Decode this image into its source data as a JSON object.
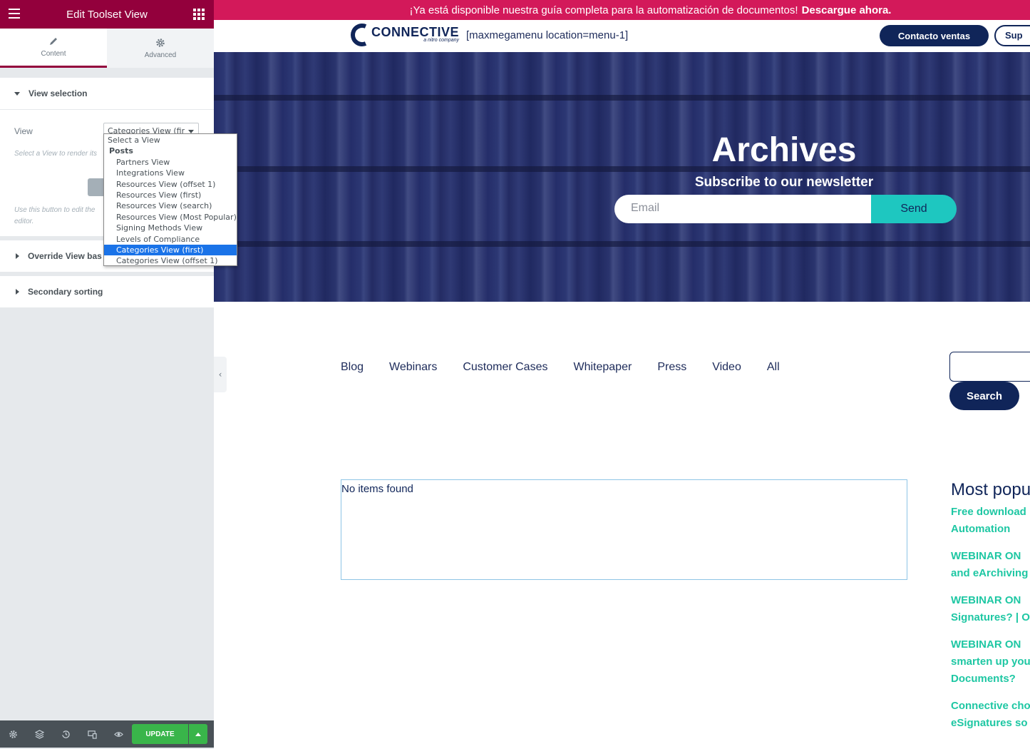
{
  "editor": {
    "title": "Edit Toolset View",
    "tabs": [
      {
        "label": "Content"
      },
      {
        "label": "Advanced"
      }
    ],
    "sections": {
      "view_selection": "View selection",
      "override": "Override View bas",
      "secondary_sorting": "Secondary sorting"
    },
    "view_label": "View",
    "view_select_value": "Categories View (first)",
    "view_help": "Select a View to render its",
    "edit_help_line1": "Use this button to edit the",
    "edit_help_line2": "editor.",
    "dropdown": {
      "top": "Select a View",
      "group": "Posts",
      "items": [
        "Partners View",
        "Integrations View",
        "Resources View (offset 1)",
        "Resources View (first)",
        "Resources View (search)",
        "Resources View (Most Popular)",
        "Signing Methods View",
        "Levels of Compliance",
        "Categories View (first)",
        "Categories View (offset 1)"
      ],
      "selected": "Categories View (first)"
    },
    "update_label": "UPDATE",
    "colors": {
      "brand": "#93003c",
      "update": "#39b54a",
      "highlight": "#1a73e8"
    }
  },
  "site": {
    "announcement": "¡Ya está disponible nuestra guía completa para la automatización de documentos!",
    "announcement_link": "Descargue ahora.",
    "logo_name": "CONNECTIVE",
    "logo_sub": "a nitro company",
    "menu_shortcode": "[maxmegamenu location=menu-1]",
    "contact_button": "Contacto ventas",
    "support_button": "Sup",
    "hero": {
      "title": "Archives",
      "subtitle": "Subscribe to our newsletter",
      "email_placeholder": "Email",
      "send_button": "Send"
    },
    "categories": [
      "Blog",
      "Webinars",
      "Customer Cases",
      "Whitepaper",
      "Press",
      "Video",
      "All"
    ],
    "search_button": "Search",
    "no_items": "No items found",
    "most_popular": {
      "title": "Most popu",
      "links": [
        [
          "Free download",
          "Automation"
        ],
        [
          "WEBINAR ON",
          "and eArchiving"
        ],
        [
          "WEBINAR ON",
          "Signatures? | O"
        ],
        [
          "WEBINAR ON",
          "smarten up you",
          "Documents?"
        ],
        [
          "Connective cho",
          "eSignatures so"
        ]
      ]
    },
    "colors": {
      "announcement": "#d3195a",
      "navy": "#102559",
      "teal": "#1ec7c0",
      "link": "#1ec7a3"
    }
  }
}
